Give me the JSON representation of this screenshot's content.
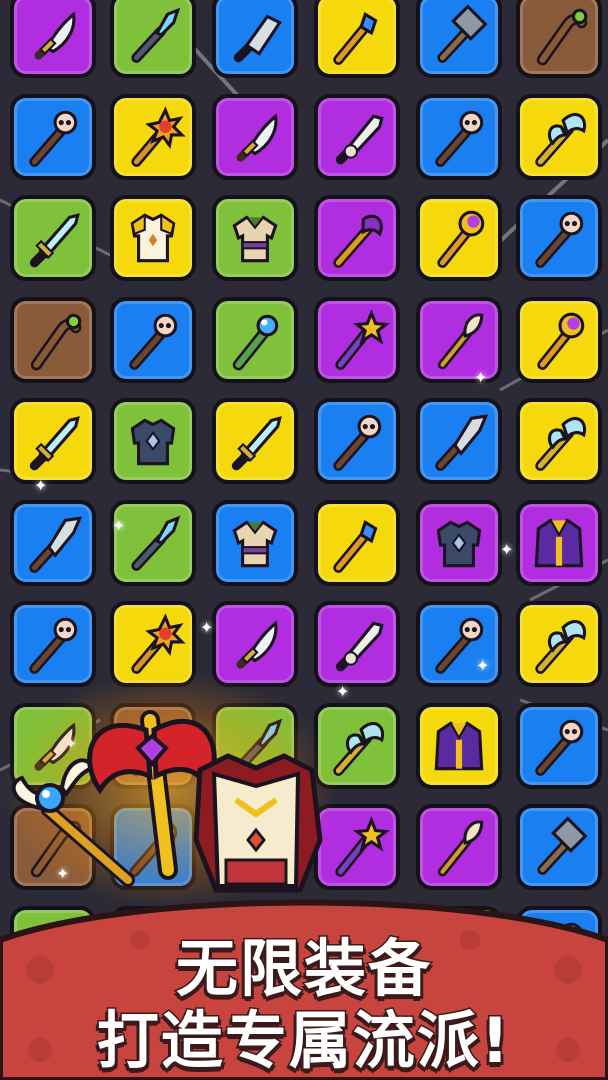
{
  "banner": {
    "line1": "无限装备",
    "line2": "打造专属流派!"
  },
  "palette": {
    "purple": "#b02ee0",
    "green": "#7fc13a",
    "blue": "#1a7ff0",
    "yellow": "#f5d90d",
    "brown": "#8a5b3a",
    "background": "#2b2a36",
    "banner_red": "#c8453f"
  },
  "grid": {
    "rows": [
      [
        {
          "color": "purple",
          "icon": "curved-dagger-icon"
        },
        {
          "color": "green",
          "icon": "crystal-wand-icon"
        },
        {
          "color": "blue",
          "icon": "cleaver-icon"
        },
        {
          "color": "yellow",
          "icon": "sapphire-staff-icon"
        },
        {
          "color": "blue",
          "icon": "war-hammer-icon"
        },
        {
          "color": "brown",
          "icon": "wooden-staff-icon"
        }
      ],
      [
        {
          "color": "blue",
          "icon": "skull-staff-icon"
        },
        {
          "color": "yellow",
          "icon": "sun-scepter-icon"
        },
        {
          "color": "purple",
          "icon": "curved-dagger-icon"
        },
        {
          "color": "purple",
          "icon": "bone-sword-icon"
        },
        {
          "color": "blue",
          "icon": "skull-staff-icon"
        },
        {
          "color": "yellow",
          "icon": "battle-axe-icon"
        }
      ],
      [
        {
          "color": "green",
          "icon": "ice-sword-icon"
        },
        {
          "color": "yellow",
          "icon": "gold-armor-icon"
        },
        {
          "color": "green",
          "icon": "tunic-icon"
        },
        {
          "color": "purple",
          "icon": "axe-staff-icon"
        },
        {
          "color": "yellow",
          "icon": "moon-staff-icon"
        },
        {
          "color": "blue",
          "icon": "skull-staff-icon"
        }
      ],
      [
        {
          "color": "brown",
          "icon": "wooden-staff-icon"
        },
        {
          "color": "blue",
          "icon": "skull-staff-icon"
        },
        {
          "color": "green",
          "icon": "orb-staff-icon"
        },
        {
          "color": "purple",
          "icon": "star-wand-icon"
        },
        {
          "color": "purple",
          "icon": "feather-wand-icon"
        },
        {
          "color": "yellow",
          "icon": "moon-staff-icon"
        }
      ],
      [
        {
          "color": "yellow",
          "icon": "ice-sword-icon"
        },
        {
          "color": "green",
          "icon": "chest-armor-icon"
        },
        {
          "color": "yellow",
          "icon": "ice-sword-icon"
        },
        {
          "color": "blue",
          "icon": "skull-staff-icon"
        },
        {
          "color": "blue",
          "icon": "spear-head-icon"
        },
        {
          "color": "yellow",
          "icon": "battle-axe-icon"
        }
      ],
      [
        {
          "color": "blue",
          "icon": "spear-head-icon"
        },
        {
          "color": "green",
          "icon": "crystal-wand-icon"
        },
        {
          "color": "blue",
          "icon": "tunic-icon"
        },
        {
          "color": "yellow",
          "icon": "sapphire-staff-icon"
        },
        {
          "color": "purple",
          "icon": "chest-armor-icon"
        },
        {
          "color": "purple",
          "icon": "robe-icon"
        }
      ],
      [
        {
          "color": "blue",
          "icon": "skull-staff-icon"
        },
        {
          "color": "yellow",
          "icon": "sun-scepter-icon"
        },
        {
          "color": "purple",
          "icon": "curved-dagger-icon"
        },
        {
          "color": "purple",
          "icon": "bone-sword-icon"
        },
        {
          "color": "blue",
          "icon": "skull-staff-icon"
        },
        {
          "color": "yellow",
          "icon": "battle-axe-icon"
        }
      ],
      [
        {
          "color": "green",
          "icon": "curved-dagger-icon"
        },
        {
          "color": "brown",
          "icon": "wooden-staff-icon"
        },
        {
          "color": "green",
          "icon": "crystal-wand-icon"
        },
        {
          "color": "green",
          "icon": "battle-axe-icon"
        },
        {
          "color": "yellow",
          "icon": "robe-icon"
        },
        {
          "color": "blue",
          "icon": "skull-staff-icon"
        }
      ],
      [
        {
          "color": "brown",
          "icon": "wooden-staff-icon"
        },
        {
          "color": "blue",
          "icon": "skull-staff-icon"
        },
        {
          "color": "green",
          "icon": "orb-staff-icon"
        },
        {
          "color": "purple",
          "icon": "star-wand-icon"
        },
        {
          "color": "purple",
          "icon": "feather-wand-icon"
        },
        {
          "color": "blue",
          "icon": "war-hammer-icon"
        }
      ],
      [
        {
          "color": "green",
          "icon": "ice-sword-icon"
        },
        {
          "color": "yellow",
          "icon": "gold-armor-icon"
        },
        {
          "color": "green",
          "icon": "tunic-icon"
        },
        {
          "color": "purple",
          "icon": "axe-staff-icon"
        },
        {
          "color": "yellow",
          "icon": "moon-staff-icon"
        },
        {
          "color": "blue",
          "icon": "skull-staff-icon"
        }
      ]
    ]
  },
  "showcase": {
    "items": [
      "winged-wand-icon",
      "red-great-axe-icon",
      "royal-armor-icon"
    ]
  }
}
